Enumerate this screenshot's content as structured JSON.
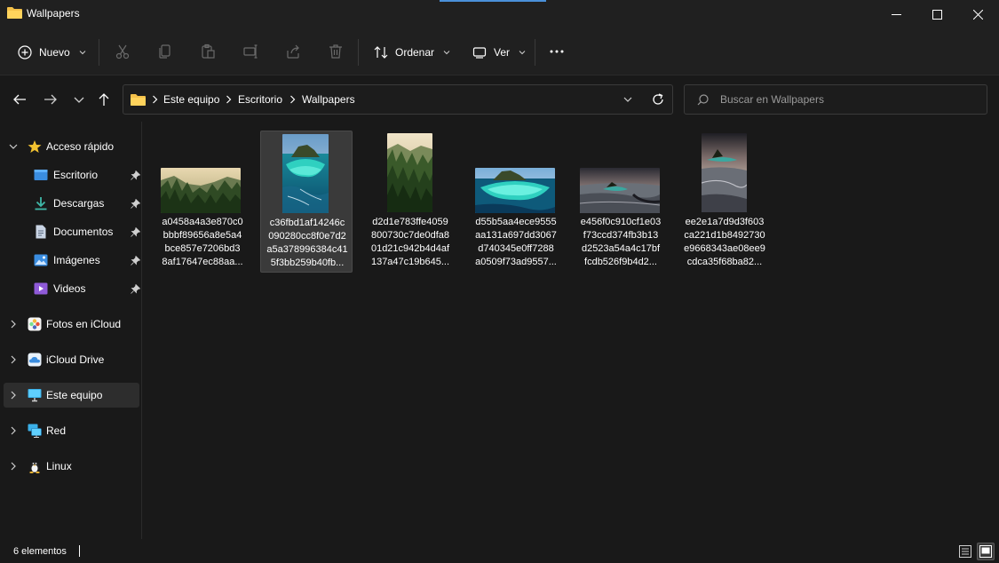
{
  "window": {
    "title": "Wallpapers",
    "accent_color": "#4a90d9"
  },
  "toolbar": {
    "new_label": "Nuevo",
    "sort_label": "Ordenar",
    "view_label": "Ver",
    "icons": [
      "plus-circle-icon",
      "cut-icon",
      "copy-icon",
      "paste-icon",
      "rename-icon",
      "share-icon",
      "delete-icon",
      "sort-icon",
      "view-icon",
      "more-icon"
    ]
  },
  "address": {
    "crumbs": [
      "Este equipo",
      "Escritorio",
      "Wallpapers"
    ]
  },
  "search": {
    "placeholder": "Buscar en Wallpapers"
  },
  "sidebar": {
    "quick_access": "Acceso rápido",
    "items": [
      {
        "label": "Escritorio",
        "icon": "desktop-icon",
        "pinned": true
      },
      {
        "label": "Descargas",
        "icon": "download-icon",
        "pinned": true
      },
      {
        "label": "Documentos",
        "icon": "document-icon",
        "pinned": true
      },
      {
        "label": "Imágenes",
        "icon": "image-icon",
        "pinned": true
      },
      {
        "label": "Videos",
        "icon": "video-icon",
        "pinned": true
      }
    ],
    "roots": [
      {
        "label": "Fotos en iCloud",
        "icon": "icloud-photos-icon"
      },
      {
        "label": "iCloud Drive",
        "icon": "icloud-drive-icon"
      },
      {
        "label": "Este equipo",
        "icon": "computer-icon",
        "selected": true
      },
      {
        "label": "Red",
        "icon": "network-icon"
      },
      {
        "label": "Linux",
        "icon": "linux-icon"
      }
    ]
  },
  "files": [
    {
      "lines": [
        "a0458a4a3e870c0",
        "bbbf89656a8e5a4",
        "bce857e7206bd3",
        "8af17647ec88aa..."
      ],
      "orientation": "landscape",
      "theme": "forest"
    },
    {
      "lines": [
        "c36fbd1af14246c",
        "090280cc8f0e7d2",
        "a5a378996384c41",
        "5f3bb259b40fb..."
      ],
      "orientation": "portrait",
      "theme": "island",
      "selected": true
    },
    {
      "lines": [
        "d2d1e783ffe4059",
        "800730c7de0dfa8",
        "01d21c942b4d4af",
        "137a47c19b645..."
      ],
      "orientation": "portrait",
      "theme": "forest"
    },
    {
      "lines": [
        "d55b5aa4ece9555",
        "aa131a697dd3067",
        "d740345e0ff7288",
        "a0509f73ad9557..."
      ],
      "orientation": "landscape",
      "theme": "island"
    },
    {
      "lines": [
        "e456f0c910cf1e03",
        "f73ccd374fb3b13",
        "d2523a54a4c17bf",
        "fcdb526f9b4d2..."
      ],
      "orientation": "landscape",
      "theme": "dusk"
    },
    {
      "lines": [
        "ee2e1a7d9d3f603",
        "ca221d1b8492730",
        "e9668343ae08ee9",
        "cdca35f68ba82..."
      ],
      "orientation": "portrait",
      "theme": "dusk"
    }
  ],
  "status": {
    "count": "6 elementos"
  }
}
